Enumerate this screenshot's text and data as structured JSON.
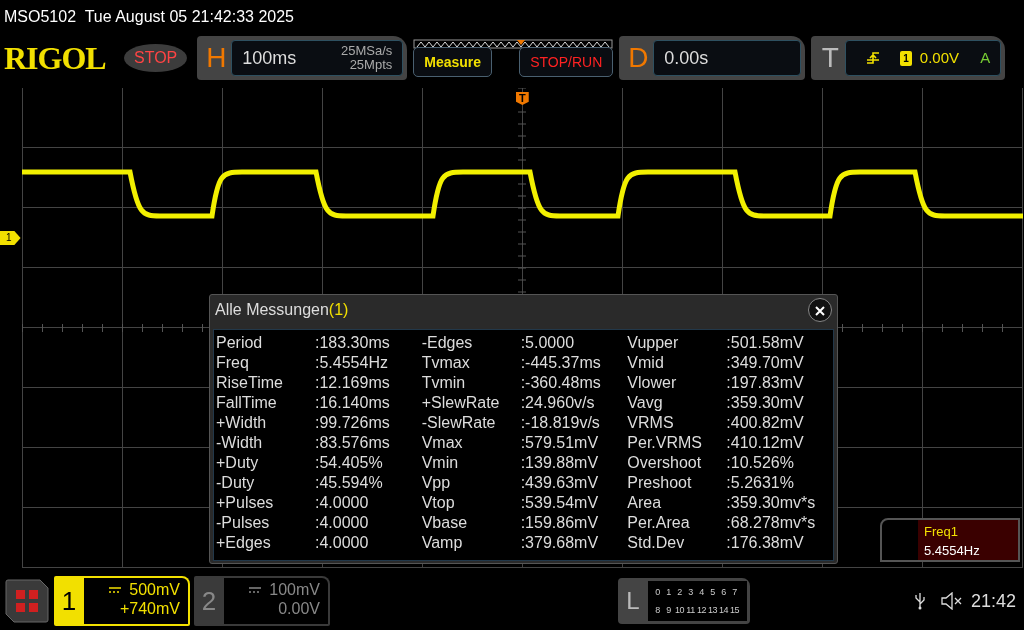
{
  "status_line": {
    "model": "MSO5102",
    "datetime": "Tue August 05 21:42:33 2025"
  },
  "toolbar": {
    "logo": "RIGOL",
    "run_state": "STOP",
    "horizontal": {
      "label": "H",
      "timebase": "100ms",
      "sample_rate": "25MSa/s",
      "memory": "25Mpts"
    },
    "buttons": [
      {
        "label": "Measure",
        "kind": "measure"
      },
      {
        "label": "STOP/RUN",
        "kind": "run"
      }
    ],
    "delay": {
      "label": "D",
      "value": "0.00s"
    },
    "trigger": {
      "label": "T",
      "source": "1",
      "level": "0.00V",
      "mode": "A"
    }
  },
  "screen": {
    "trigger_marker": "T",
    "channel_marker": "1"
  },
  "measurement_dialog": {
    "title": "Alle Messungen",
    "count": "(1)",
    "columns": [
      [
        {
          "name": "Period",
          "value": ":183.30ms"
        },
        {
          "name": "Freq",
          "value": ":5.4554Hz"
        },
        {
          "name": "RiseTime",
          "value": ":12.169ms"
        },
        {
          "name": "FallTime",
          "value": ":16.140ms"
        },
        {
          "name": "+Width",
          "value": ":99.726ms"
        },
        {
          "name": "-Width",
          "value": ":83.576ms"
        },
        {
          "name": "+Duty",
          "value": ":54.405%"
        },
        {
          "name": "-Duty",
          "value": ":45.594%"
        },
        {
          "name": "+Pulses",
          "value": ":4.0000"
        },
        {
          "name": "-Pulses",
          "value": ":4.0000"
        },
        {
          "name": "+Edges",
          "value": ":4.0000"
        }
      ],
      [
        {
          "name": "-Edges",
          "value": ":5.0000"
        },
        {
          "name": "Tvmax",
          "value": ":-445.37ms"
        },
        {
          "name": "Tvmin",
          "value": ":-360.48ms"
        },
        {
          "name": "+SlewRate",
          "value": ":24.960v/s"
        },
        {
          "name": "-SlewRate",
          "value": ":-18.819v/s"
        },
        {
          "name": "Vmax",
          "value": ":579.51mV"
        },
        {
          "name": "Vmin",
          "value": ":139.88mV"
        },
        {
          "name": "Vpp",
          "value": ":439.63mV"
        },
        {
          "name": "Vtop",
          "value": ":539.54mV"
        },
        {
          "name": "Vbase",
          "value": ":159.86mV"
        },
        {
          "name": "Vamp",
          "value": ":379.68mV"
        }
      ],
      [
        {
          "name": "Vupper",
          "value": ":501.58mV"
        },
        {
          "name": "Vmid",
          "value": ":349.70mV"
        },
        {
          "name": "Vlower",
          "value": ":197.83mV"
        },
        {
          "name": "Vavg",
          "value": ":359.30mV"
        },
        {
          "name": "VRMS",
          "value": ":400.82mV"
        },
        {
          "name": "Per.VRMS",
          "value": ":410.12mV"
        },
        {
          "name": "Overshoot",
          "value": ":10.526%"
        },
        {
          "name": "Preshoot",
          "value": ":5.2631%"
        },
        {
          "name": "Area",
          "value": ":359.30mv*s"
        },
        {
          "name": "Per.Area",
          "value": ":68.278mv*s"
        },
        {
          "name": "Std.Dev",
          "value": ":176.38mV"
        }
      ]
    ]
  },
  "freq_badge": {
    "label": "Freq1",
    "value": "5.4554Hz"
  },
  "channels": [
    {
      "number": "1",
      "scale": "500mV",
      "offset": "+740mV",
      "selected": true
    },
    {
      "number": "2",
      "scale": "100mV",
      "offset": "0.00V",
      "selected": false
    }
  ],
  "logic": {
    "label": "L",
    "rows": [
      [
        "0",
        "1",
        "2",
        "3",
        "4",
        "5",
        "6",
        "7"
      ],
      [
        "8",
        "9",
        "10",
        "11",
        "12",
        "13",
        "14",
        "15"
      ]
    ]
  },
  "status_bar": {
    "clock": "21:42"
  }
}
